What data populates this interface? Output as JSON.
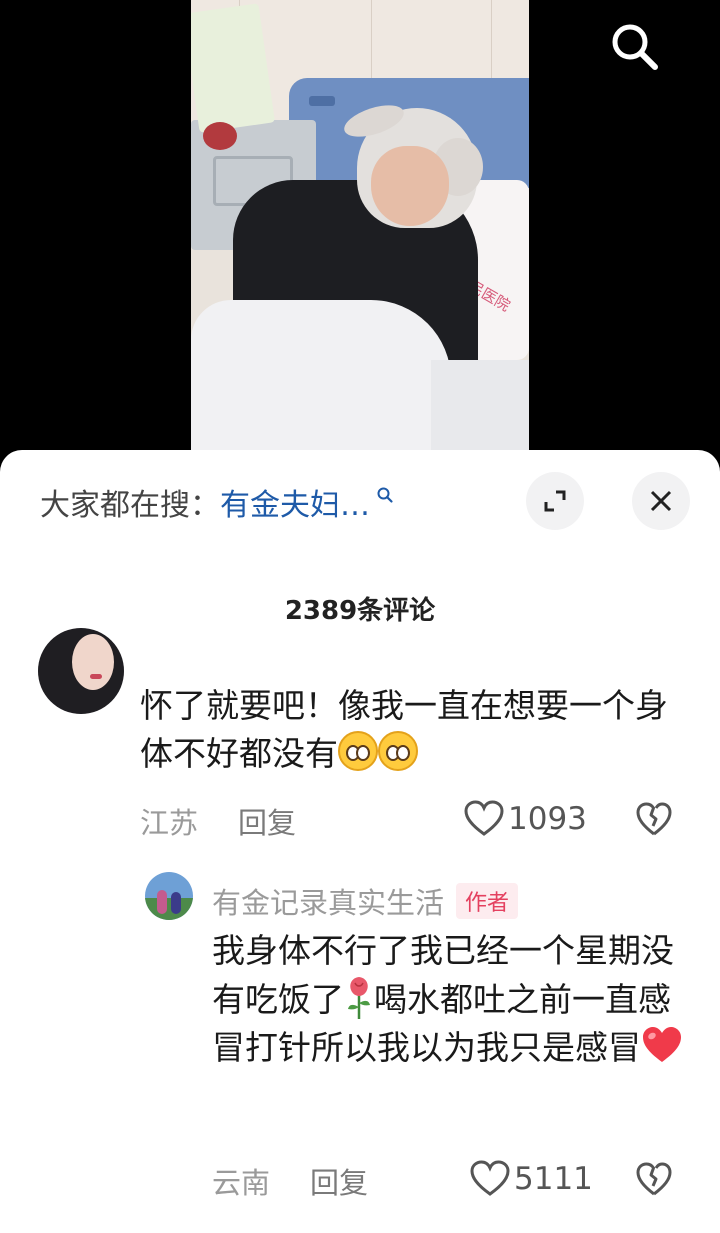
{
  "search_bar": {
    "prefix": "大家都在搜：",
    "term": "有金夫妇…"
  },
  "comments_header": {
    "count_title": "2389条评论"
  },
  "comments": [
    {
      "text": "怀了就要吧！像我一直在想要一个身体不好都没有",
      "emojis": [
        "pleading-face",
        "pleading-face"
      ],
      "location": "江苏",
      "reply_label": "回复",
      "likes": "1093"
    }
  ],
  "reply": {
    "author": "有金记录真实生活",
    "badge": "作者",
    "text_part1": "我身体不行了我已经一个星期没有吃饭了",
    "text_part2": "喝水都吐之前一直感冒打针所以我以为我只是感冒",
    "emojis": [
      "rose",
      "red-heart"
    ],
    "location": "云南",
    "reply_label": "回复",
    "likes": "5111"
  },
  "photo": {
    "pillow_text": "民医院"
  },
  "colors": {
    "search_term": "#1e5aa8",
    "author_badge_bg": "#fdecef",
    "author_badge_text": "#e4405f",
    "meta_text": "#9a9a9a"
  }
}
